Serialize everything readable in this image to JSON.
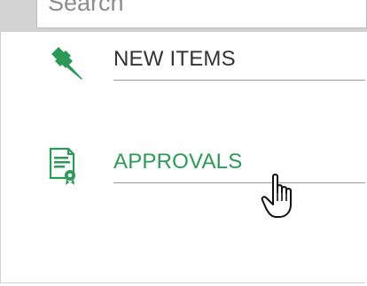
{
  "search": {
    "placeholder": "Search"
  },
  "menu": {
    "items": [
      {
        "label": "NEW ITEMS",
        "icon": "pushpin-icon",
        "state": "normal"
      },
      {
        "label": "APPROVALS",
        "icon": "certificate-document-icon",
        "state": "hover"
      }
    ]
  },
  "colors": {
    "accent_green": "#2c9a57",
    "text_default": "#333333",
    "topbar_grey": "#d2d2d2"
  },
  "cursor": {
    "icon": "hand-pointer-icon"
  }
}
